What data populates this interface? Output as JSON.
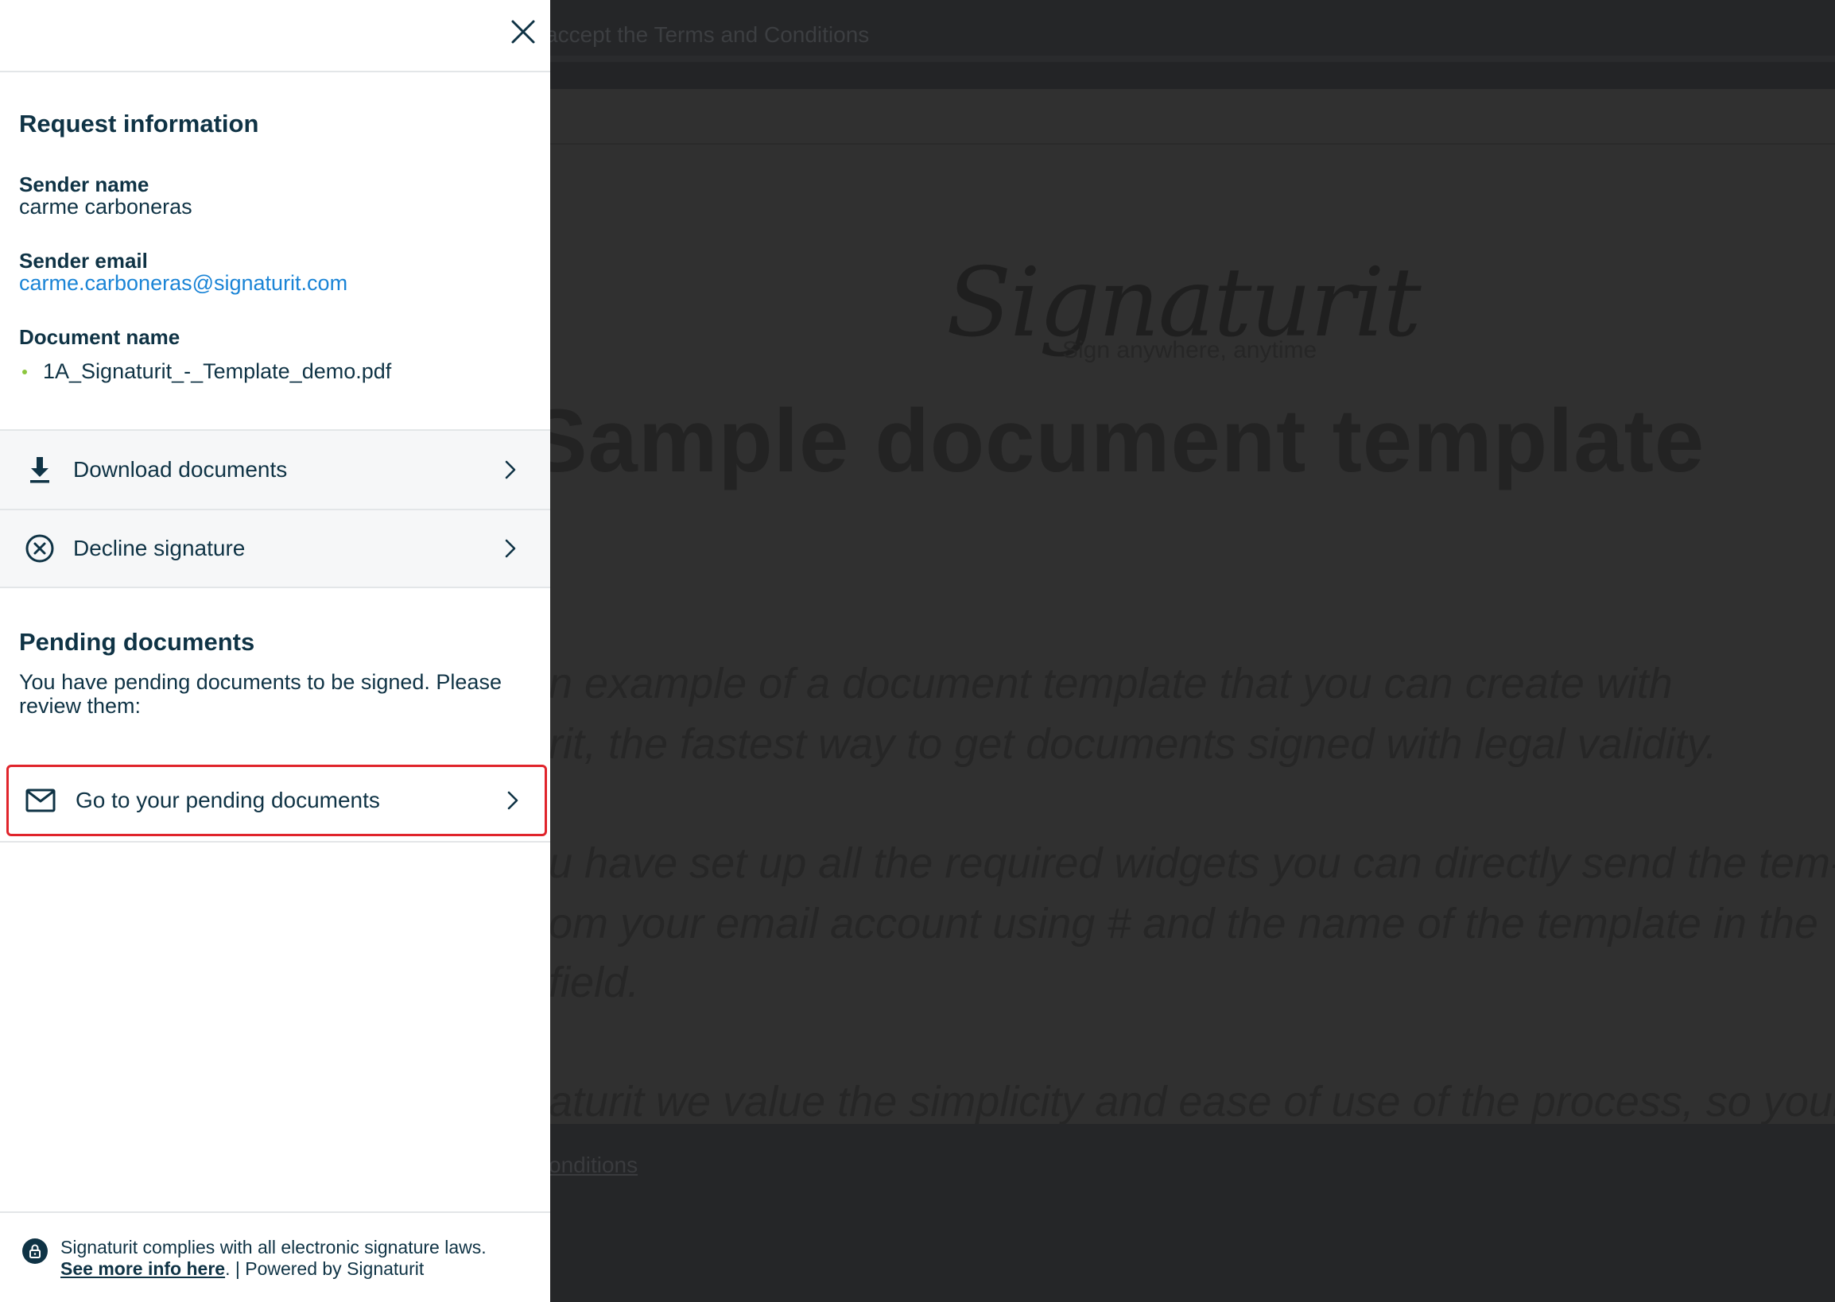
{
  "background": {
    "topbar_text": "accept the Terms and Conditions",
    "logo_name": "Signaturit",
    "logo_tagline": "Sign anywhere, anytime",
    "doc_title": "Sample document template",
    "paragraphs": [
      "n example of a document template that you can create with",
      "rit, the fastest way to get documents signed with legal validity.",
      "u have set up all the required widgets you can directly send the tem-",
      "om your email account using # and the name of the template in the",
      "field.",
      "aturit we value the simplicity and ease of use of the process, so your"
    ],
    "footer_link": "onditions"
  },
  "panel": {
    "request_info": {
      "title": "Request information",
      "sender_name_label": "Sender name",
      "sender_name_value": "carme carboneras",
      "sender_email_label": "Sender email",
      "sender_email_value": "carme.carboneras@signaturit.com",
      "document_name_label": "Document name",
      "document_name_value": "1A_Signaturit_-_Template_demo.pdf"
    },
    "actions": {
      "download_label": "Download documents",
      "decline_label": "Decline signature"
    },
    "pending": {
      "title": "Pending documents",
      "text": "You have pending documents to be signed. Please review them:",
      "button_label": "Go to your pending documents"
    },
    "footer": {
      "line1": "Signaturit complies with all electronic signature laws.",
      "link": "See more info here",
      "line2_suffix": ". | Powered by Signaturit"
    }
  },
  "colors": {
    "text_primary": "#0f3345",
    "link_blue": "#1a84d6",
    "highlight_red": "#e0242b",
    "doc_dot_green": "#8cc63e"
  },
  "icons": [
    "close-icon",
    "download-icon",
    "decline-icon",
    "chevron-right-icon",
    "mail-icon",
    "lock-icon"
  ]
}
